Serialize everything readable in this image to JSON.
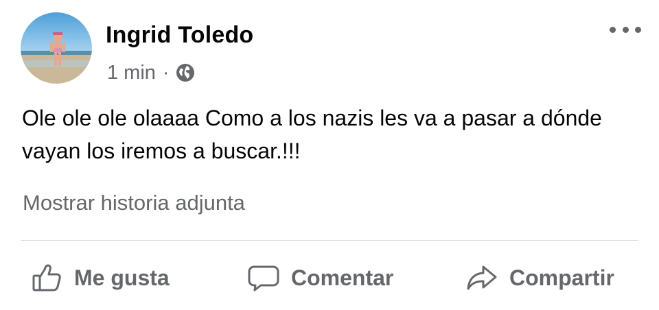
{
  "post": {
    "author": "Ingrid Toledo",
    "timestamp": "1 min",
    "separator": "·",
    "audience_icon": "globe-icon",
    "more_icon": "more-options-icon",
    "text": "Ole ole ole olaaaa Como a los nazis les va a pasar a dónde vayan los iremos a buscar.!!!",
    "attached_link": "Mostrar historia adjunta"
  },
  "actions": {
    "like": {
      "label": "Me gusta",
      "icon": "thumbs-up-icon"
    },
    "comment": {
      "label": "Comentar",
      "icon": "comment-bubble-icon"
    },
    "share": {
      "label": "Compartir",
      "icon": "share-arrow-icon"
    }
  },
  "colors": {
    "text_primary": "#050505",
    "text_secondary": "#65676b",
    "divider": "#dadde1",
    "background": "#ffffff"
  }
}
